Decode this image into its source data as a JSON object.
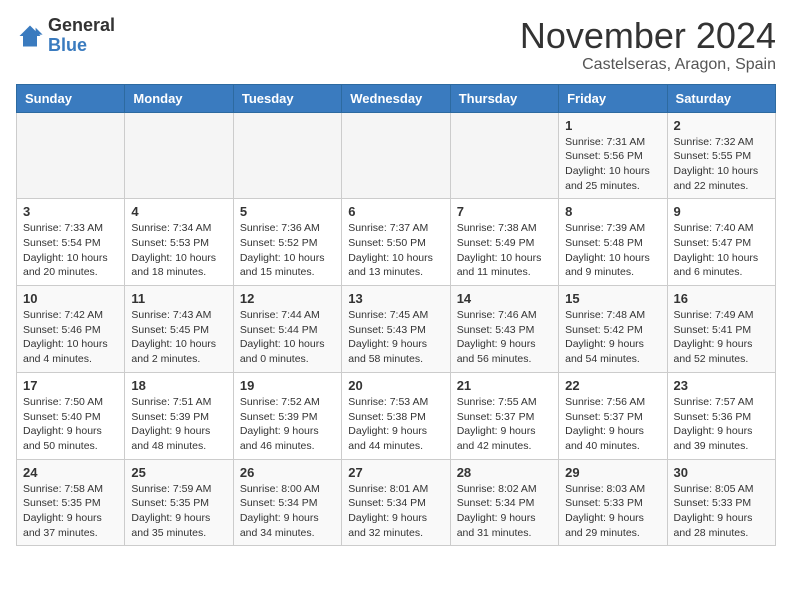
{
  "header": {
    "logo_general": "General",
    "logo_blue": "Blue",
    "month": "November 2024",
    "location": "Castelseras, Aragon, Spain"
  },
  "weekdays": [
    "Sunday",
    "Monday",
    "Tuesday",
    "Wednesday",
    "Thursday",
    "Friday",
    "Saturday"
  ],
  "weeks": [
    [
      {
        "day": "",
        "info": ""
      },
      {
        "day": "",
        "info": ""
      },
      {
        "day": "",
        "info": ""
      },
      {
        "day": "",
        "info": ""
      },
      {
        "day": "",
        "info": ""
      },
      {
        "day": "1",
        "info": "Sunrise: 7:31 AM\nSunset: 5:56 PM\nDaylight: 10 hours\nand 25 minutes."
      },
      {
        "day": "2",
        "info": "Sunrise: 7:32 AM\nSunset: 5:55 PM\nDaylight: 10 hours\nand 22 minutes."
      }
    ],
    [
      {
        "day": "3",
        "info": "Sunrise: 7:33 AM\nSunset: 5:54 PM\nDaylight: 10 hours\nand 20 minutes."
      },
      {
        "day": "4",
        "info": "Sunrise: 7:34 AM\nSunset: 5:53 PM\nDaylight: 10 hours\nand 18 minutes."
      },
      {
        "day": "5",
        "info": "Sunrise: 7:36 AM\nSunset: 5:52 PM\nDaylight: 10 hours\nand 15 minutes."
      },
      {
        "day": "6",
        "info": "Sunrise: 7:37 AM\nSunset: 5:50 PM\nDaylight: 10 hours\nand 13 minutes."
      },
      {
        "day": "7",
        "info": "Sunrise: 7:38 AM\nSunset: 5:49 PM\nDaylight: 10 hours\nand 11 minutes."
      },
      {
        "day": "8",
        "info": "Sunrise: 7:39 AM\nSunset: 5:48 PM\nDaylight: 10 hours\nand 9 minutes."
      },
      {
        "day": "9",
        "info": "Sunrise: 7:40 AM\nSunset: 5:47 PM\nDaylight: 10 hours\nand 6 minutes."
      }
    ],
    [
      {
        "day": "10",
        "info": "Sunrise: 7:42 AM\nSunset: 5:46 PM\nDaylight: 10 hours\nand 4 minutes."
      },
      {
        "day": "11",
        "info": "Sunrise: 7:43 AM\nSunset: 5:45 PM\nDaylight: 10 hours\nand 2 minutes."
      },
      {
        "day": "12",
        "info": "Sunrise: 7:44 AM\nSunset: 5:44 PM\nDaylight: 10 hours\nand 0 minutes."
      },
      {
        "day": "13",
        "info": "Sunrise: 7:45 AM\nSunset: 5:43 PM\nDaylight: 9 hours\nand 58 minutes."
      },
      {
        "day": "14",
        "info": "Sunrise: 7:46 AM\nSunset: 5:43 PM\nDaylight: 9 hours\nand 56 minutes."
      },
      {
        "day": "15",
        "info": "Sunrise: 7:48 AM\nSunset: 5:42 PM\nDaylight: 9 hours\nand 54 minutes."
      },
      {
        "day": "16",
        "info": "Sunrise: 7:49 AM\nSunset: 5:41 PM\nDaylight: 9 hours\nand 52 minutes."
      }
    ],
    [
      {
        "day": "17",
        "info": "Sunrise: 7:50 AM\nSunset: 5:40 PM\nDaylight: 9 hours\nand 50 minutes."
      },
      {
        "day": "18",
        "info": "Sunrise: 7:51 AM\nSunset: 5:39 PM\nDaylight: 9 hours\nand 48 minutes."
      },
      {
        "day": "19",
        "info": "Sunrise: 7:52 AM\nSunset: 5:39 PM\nDaylight: 9 hours\nand 46 minutes."
      },
      {
        "day": "20",
        "info": "Sunrise: 7:53 AM\nSunset: 5:38 PM\nDaylight: 9 hours\nand 44 minutes."
      },
      {
        "day": "21",
        "info": "Sunrise: 7:55 AM\nSunset: 5:37 PM\nDaylight: 9 hours\nand 42 minutes."
      },
      {
        "day": "22",
        "info": "Sunrise: 7:56 AM\nSunset: 5:37 PM\nDaylight: 9 hours\nand 40 minutes."
      },
      {
        "day": "23",
        "info": "Sunrise: 7:57 AM\nSunset: 5:36 PM\nDaylight: 9 hours\nand 39 minutes."
      }
    ],
    [
      {
        "day": "24",
        "info": "Sunrise: 7:58 AM\nSunset: 5:35 PM\nDaylight: 9 hours\nand 37 minutes."
      },
      {
        "day": "25",
        "info": "Sunrise: 7:59 AM\nSunset: 5:35 PM\nDaylight: 9 hours\nand 35 minutes."
      },
      {
        "day": "26",
        "info": "Sunrise: 8:00 AM\nSunset: 5:34 PM\nDaylight: 9 hours\nand 34 minutes."
      },
      {
        "day": "27",
        "info": "Sunrise: 8:01 AM\nSunset: 5:34 PM\nDaylight: 9 hours\nand 32 minutes."
      },
      {
        "day": "28",
        "info": "Sunrise: 8:02 AM\nSunset: 5:34 PM\nDaylight: 9 hours\nand 31 minutes."
      },
      {
        "day": "29",
        "info": "Sunrise: 8:03 AM\nSunset: 5:33 PM\nDaylight: 9 hours\nand 29 minutes."
      },
      {
        "day": "30",
        "info": "Sunrise: 8:05 AM\nSunset: 5:33 PM\nDaylight: 9 hours\nand 28 minutes."
      }
    ]
  ]
}
